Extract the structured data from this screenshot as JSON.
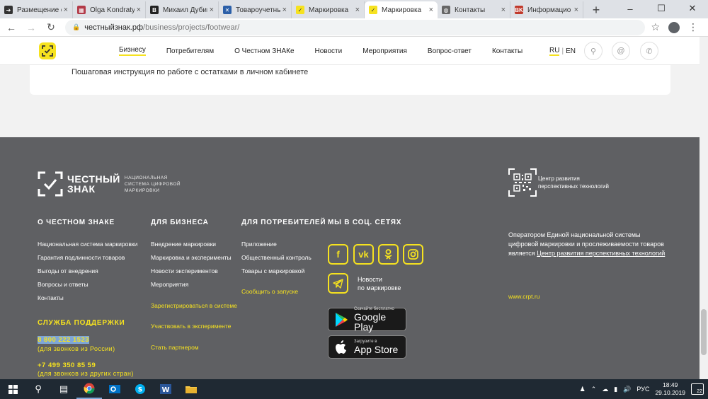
{
  "browser": {
    "tabs": [
      {
        "title": "Размещение о",
        "icon": "circle-arrow-icon",
        "fav_color": "#333333",
        "fav_glyph": "➔"
      },
      {
        "title": "Olga Kondraty",
        "icon": "document-icon",
        "fav_color": "#b23a48",
        "fav_glyph": "▦"
      },
      {
        "title": "Михаил Дубин",
        "icon": "b-letter-icon",
        "fav_color": "#222222",
        "fav_glyph": "B"
      },
      {
        "title": "Товароучетны",
        "icon": "bird-icon",
        "fav_color": "#2b5fa8",
        "fav_glyph": "✕"
      },
      {
        "title": "Маркировка",
        "icon": "chestny-znak-icon",
        "fav_color": "#f6e21f",
        "fav_glyph": "✓"
      },
      {
        "title": "Маркировка",
        "icon": "chestny-znak-icon",
        "fav_color": "#f6e21f",
        "fav_glyph": "✓",
        "active": true
      },
      {
        "title": "Контакты",
        "icon": "globe-icon",
        "fav_color": "#666666",
        "fav_glyph": "◍"
      },
      {
        "title": "Информацио",
        "icon": "vk-circle-icon",
        "fav_color": "#c0392b",
        "fav_glyph": "BK"
      }
    ],
    "url_host": "честныйзнак.рф",
    "url_path": "/business/projects/footwear/"
  },
  "header": {
    "nav": [
      "Бизнесу",
      "Потребителям",
      "О Честном ЗНАКе",
      "Новости",
      "Мероприятия",
      "Вопрос-ответ",
      "Контакты"
    ],
    "lang_ru": "RU",
    "lang_en": "EN"
  },
  "content": {
    "card_text": "Пошаговая инструкция по работе с остатками в личном кабинете"
  },
  "footer": {
    "logo_main_1": "ЧЕСТНЫЙ",
    "logo_main_2": "ЗНАК",
    "logo_sub_1": "НАЦИОНАЛЬНАЯ",
    "logo_sub_2": "СИСТЕМА ЦИФРОВОЙ",
    "logo_sub_3": "МАРКИРОВКИ",
    "col1_title": "О ЧЕСТНОМ ЗНАКЕ",
    "col1_links": [
      "Национальная система маркировки",
      "Гарантия подлинности товаров",
      "Выгоды от внедрения",
      "Вопросы и ответы",
      "Контакты"
    ],
    "col2_title": "ДЛЯ БИЗНЕСА",
    "col2_links": [
      "Внедрение маркировки",
      "Маркировка и эксперименты",
      "Новости экспериментов",
      "Мероприятия"
    ],
    "col2_yellow_links": [
      "Зарегистрироваться в системе",
      "Участвовать в эксперименте",
      "Стать партнером"
    ],
    "col3_title": "ДЛЯ ПОТРЕБИТЕЛЕЙ",
    "col3_links": [
      "Приложение",
      "Общественный контроль",
      "Товары с маркировкой"
    ],
    "col3_yellow_link": "Сообщить о запуске",
    "col4_title": "МЫ В СОЦ. СЕТЯХ",
    "telegram_label_1": "Новости",
    "telegram_label_2": "по маркировке",
    "google_play_small": "Скачайте бесплатно",
    "google_play_big": "Google Play",
    "app_store_small": "Загрузите в",
    "app_store_big": "App Store",
    "support_title": "СЛУЖБА ПОДДЕРЖКИ",
    "phone_1": "8 800 222 1523",
    "phone_1_note": "(для звонков из России)",
    "phone_2": "+7 499 350 85 59",
    "phone_2_note": "(для звонков из других стран)",
    "crpt_name_1": "Центр развития",
    "crpt_name_2": "перспективных технологий",
    "operator_text": "Оператором Единой национальной системы цифровой маркировки и прослеживаемости товаров является ",
    "operator_link": "Центр развития перспективных технологий",
    "crpt_url": "www.crpt.ru"
  },
  "taskbar": {
    "lang": "РУС",
    "time": "18:49",
    "date": "29.10.2019",
    "notif_count": "22"
  },
  "colors": {
    "brand_yellow": "#f6e21f",
    "footer_bg": "#5f6063"
  }
}
